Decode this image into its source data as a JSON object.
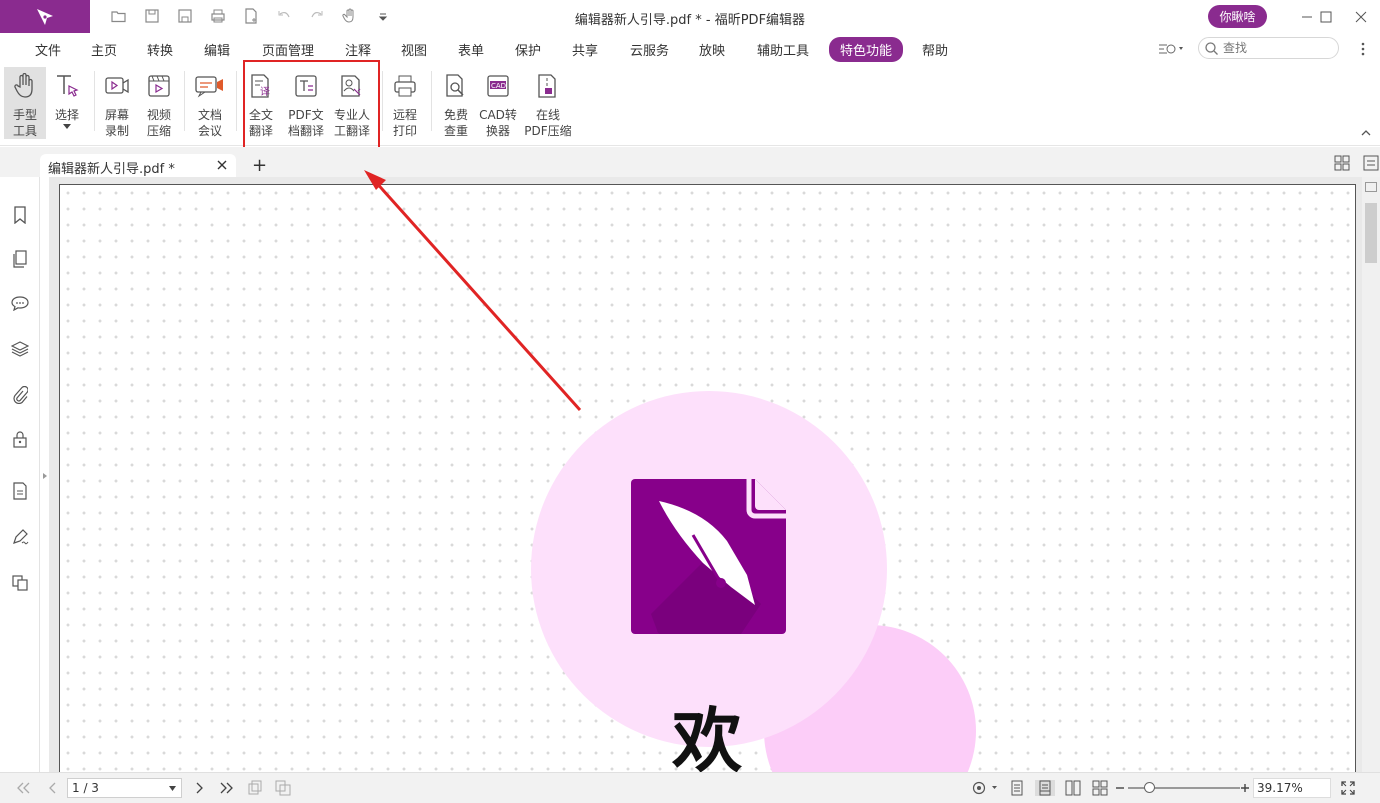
{
  "window": {
    "title": "编辑器新人引导.pdf * - 福昕PDF编辑器",
    "user_label": "你瞅啥"
  },
  "quick_access": {
    "icons": [
      "open-icon",
      "save-icon",
      "save-as-icon",
      "print-icon",
      "new-doc-icon",
      "undo-icon",
      "redo-icon",
      "hand-icon",
      "customize-icon"
    ]
  },
  "menu": {
    "items": [
      "文件",
      "主页",
      "转换",
      "编辑",
      "页面管理",
      "注释",
      "视图",
      "表单",
      "保护",
      "共享",
      "云服务",
      "放映",
      "辅助工具",
      "特色功能",
      "帮助"
    ],
    "active": "特色功能"
  },
  "search": {
    "placeholder": "查找"
  },
  "ribbon": {
    "buttons": [
      {
        "id": "hand-tool",
        "label": "手型\n工具"
      },
      {
        "id": "select",
        "label": "选择"
      },
      {
        "id": "screen-record",
        "label": "屏幕\n录制"
      },
      {
        "id": "video-compress",
        "label": "视频\n压缩"
      },
      {
        "id": "doc-meeting",
        "label": "文档\n会议"
      },
      {
        "id": "full-translate",
        "label": "全文\n翻译"
      },
      {
        "id": "pdf-doc-translate",
        "label": "PDF文\n档翻译"
      },
      {
        "id": "pro-translate",
        "label": "专业人\n工翻译"
      },
      {
        "id": "remote-print",
        "label": "远程\n打印"
      },
      {
        "id": "free-check",
        "label": "免费\n查重"
      },
      {
        "id": "cad-convert",
        "label": "CAD转\n换器"
      },
      {
        "id": "online-compress",
        "label": "在线\nPDF压缩"
      }
    ]
  },
  "tabs": {
    "doc_name": "编辑器新人引导.pdf *",
    "new_tab": "+"
  },
  "document": {
    "welcome_char": "欢"
  },
  "statusbar": {
    "page": "1 / 3",
    "zoom": "39.17%"
  },
  "colors": {
    "brand": "#8a2b8f",
    "highlight": "#e02424",
    "circle_light": "#fde0fb",
    "circle_pink": "#fccdf8"
  }
}
